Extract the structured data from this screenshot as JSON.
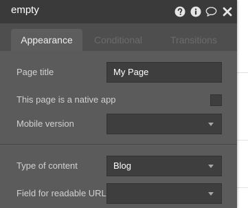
{
  "header": {
    "title": "empty",
    "icons": [
      "help-circle-icon",
      "info-circle-icon",
      "comment-icon",
      "close-icon"
    ]
  },
  "tabs": [
    {
      "label": "Appearance",
      "active": true
    },
    {
      "label": "Conditional",
      "active": false
    },
    {
      "label": "Transitions",
      "active": false
    }
  ],
  "fields": {
    "page_title": {
      "label": "Page title",
      "value": "My Page"
    },
    "native_app": {
      "label": "This page is a native app",
      "checked": false
    },
    "mobile_version": {
      "label": "Mobile version",
      "value": ""
    },
    "type_of_content": {
      "label": "Type of content",
      "value": "Blog"
    },
    "readable_url": {
      "label": "Field for readable URL",
      "value": ""
    }
  },
  "colors": {
    "header_bg": "#3a3a3a",
    "panel_bg": "#5b5b5b",
    "field_bg": "#3e3e3e",
    "active_tab_bg": "#5d5d5d"
  }
}
